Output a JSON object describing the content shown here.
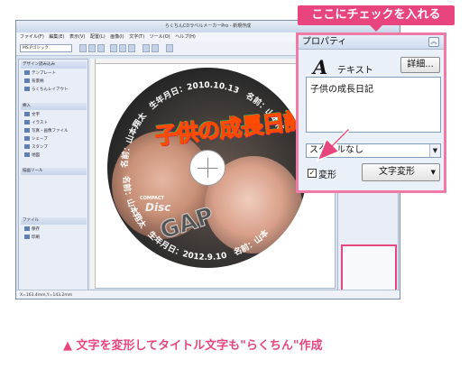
{
  "callout": {
    "tag_text": "ここにチェックを入れる"
  },
  "property_panel": {
    "title": "プロパティ",
    "text_type": "テキスト",
    "detail_button": "詳細...",
    "text_value": "子供の成長日記",
    "select_value": "スタイルなし",
    "checkbox_label": "変形",
    "transform_button": "文字変形"
  },
  "disc": {
    "title": "子供の成長日記",
    "arc_top": "名前：山本翔太　生年月日：2010.10.13　名前：山本花",
    "arc_bottom": "名前：山本翔太　生年月日：2012.9.10　名前：山本",
    "logo_compact": "COMPACT",
    "logo_disc": "Disc",
    "logo_gap": "GAP"
  },
  "window": {
    "title": "らくちんCDラベルメーカーPro - 新規作成",
    "menus": [
      "ファイル(F)",
      "編集(E)",
      "表示(V)",
      "配置(L)",
      "画像(I)",
      "文字(T)",
      "ツール(O)",
      "ヘルプ(H)"
    ],
    "font_value": "MS Pゴシック",
    "left_sections": {
      "design": "デザイン読み込み",
      "design_items": [
        "テンプレート",
        "背景柄",
        "らくちんレイアウト"
      ],
      "insert": "挿入",
      "insert_items": [
        "文字",
        "イラスト",
        "写真・画像ファイル",
        "シェープ",
        "スタンプ",
        "地図"
      ],
      "tools": "描画ツール",
      "file": "ファイル",
      "file_items": [
        "保存",
        "印刷"
      ]
    },
    "statusbar": "X=163.4mm,Y=143.2mm"
  },
  "caption": "▲ 文字を変形してタイトル文字も\"らくちん\"作成"
}
